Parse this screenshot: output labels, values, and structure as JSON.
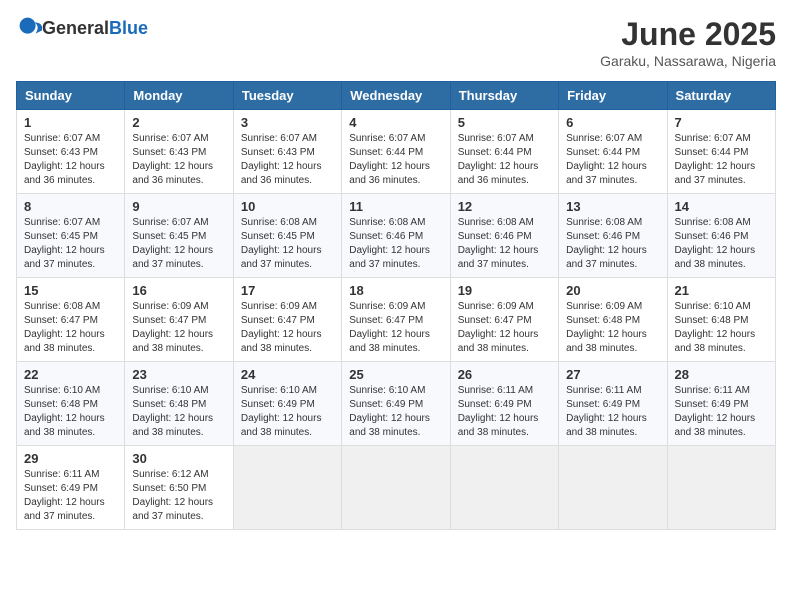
{
  "logo": {
    "general": "General",
    "blue": "Blue"
  },
  "title": "June 2025",
  "location": "Garaku, Nassarawa, Nigeria",
  "weekdays": [
    "Sunday",
    "Monday",
    "Tuesday",
    "Wednesday",
    "Thursday",
    "Friday",
    "Saturday"
  ],
  "weeks": [
    [
      {
        "day": "1",
        "sunrise": "6:07 AM",
        "sunset": "6:43 PM",
        "daylight": "12 hours and 36 minutes."
      },
      {
        "day": "2",
        "sunrise": "6:07 AM",
        "sunset": "6:43 PM",
        "daylight": "12 hours and 36 minutes."
      },
      {
        "day": "3",
        "sunrise": "6:07 AM",
        "sunset": "6:43 PM",
        "daylight": "12 hours and 36 minutes."
      },
      {
        "day": "4",
        "sunrise": "6:07 AM",
        "sunset": "6:44 PM",
        "daylight": "12 hours and 36 minutes."
      },
      {
        "day": "5",
        "sunrise": "6:07 AM",
        "sunset": "6:44 PM",
        "daylight": "12 hours and 36 minutes."
      },
      {
        "day": "6",
        "sunrise": "6:07 AM",
        "sunset": "6:44 PM",
        "daylight": "12 hours and 37 minutes."
      },
      {
        "day": "7",
        "sunrise": "6:07 AM",
        "sunset": "6:44 PM",
        "daylight": "12 hours and 37 minutes."
      }
    ],
    [
      {
        "day": "8",
        "sunrise": "6:07 AM",
        "sunset": "6:45 PM",
        "daylight": "12 hours and 37 minutes."
      },
      {
        "day": "9",
        "sunrise": "6:07 AM",
        "sunset": "6:45 PM",
        "daylight": "12 hours and 37 minutes."
      },
      {
        "day": "10",
        "sunrise": "6:08 AM",
        "sunset": "6:45 PM",
        "daylight": "12 hours and 37 minutes."
      },
      {
        "day": "11",
        "sunrise": "6:08 AM",
        "sunset": "6:46 PM",
        "daylight": "12 hours and 37 minutes."
      },
      {
        "day": "12",
        "sunrise": "6:08 AM",
        "sunset": "6:46 PM",
        "daylight": "12 hours and 37 minutes."
      },
      {
        "day": "13",
        "sunrise": "6:08 AM",
        "sunset": "6:46 PM",
        "daylight": "12 hours and 37 minutes."
      },
      {
        "day": "14",
        "sunrise": "6:08 AM",
        "sunset": "6:46 PM",
        "daylight": "12 hours and 38 minutes."
      }
    ],
    [
      {
        "day": "15",
        "sunrise": "6:08 AM",
        "sunset": "6:47 PM",
        "daylight": "12 hours and 38 minutes."
      },
      {
        "day": "16",
        "sunrise": "6:09 AM",
        "sunset": "6:47 PM",
        "daylight": "12 hours and 38 minutes."
      },
      {
        "day": "17",
        "sunrise": "6:09 AM",
        "sunset": "6:47 PM",
        "daylight": "12 hours and 38 minutes."
      },
      {
        "day": "18",
        "sunrise": "6:09 AM",
        "sunset": "6:47 PM",
        "daylight": "12 hours and 38 minutes."
      },
      {
        "day": "19",
        "sunrise": "6:09 AM",
        "sunset": "6:47 PM",
        "daylight": "12 hours and 38 minutes."
      },
      {
        "day": "20",
        "sunrise": "6:09 AM",
        "sunset": "6:48 PM",
        "daylight": "12 hours and 38 minutes."
      },
      {
        "day": "21",
        "sunrise": "6:10 AM",
        "sunset": "6:48 PM",
        "daylight": "12 hours and 38 minutes."
      }
    ],
    [
      {
        "day": "22",
        "sunrise": "6:10 AM",
        "sunset": "6:48 PM",
        "daylight": "12 hours and 38 minutes."
      },
      {
        "day": "23",
        "sunrise": "6:10 AM",
        "sunset": "6:48 PM",
        "daylight": "12 hours and 38 minutes."
      },
      {
        "day": "24",
        "sunrise": "6:10 AM",
        "sunset": "6:49 PM",
        "daylight": "12 hours and 38 minutes."
      },
      {
        "day": "25",
        "sunrise": "6:10 AM",
        "sunset": "6:49 PM",
        "daylight": "12 hours and 38 minutes."
      },
      {
        "day": "26",
        "sunrise": "6:11 AM",
        "sunset": "6:49 PM",
        "daylight": "12 hours and 38 minutes."
      },
      {
        "day": "27",
        "sunrise": "6:11 AM",
        "sunset": "6:49 PM",
        "daylight": "12 hours and 38 minutes."
      },
      {
        "day": "28",
        "sunrise": "6:11 AM",
        "sunset": "6:49 PM",
        "daylight": "12 hours and 38 minutes."
      }
    ],
    [
      {
        "day": "29",
        "sunrise": "6:11 AM",
        "sunset": "6:49 PM",
        "daylight": "12 hours and 37 minutes."
      },
      {
        "day": "30",
        "sunrise": "6:12 AM",
        "sunset": "6:50 PM",
        "daylight": "12 hours and 37 minutes."
      },
      null,
      null,
      null,
      null,
      null
    ]
  ]
}
